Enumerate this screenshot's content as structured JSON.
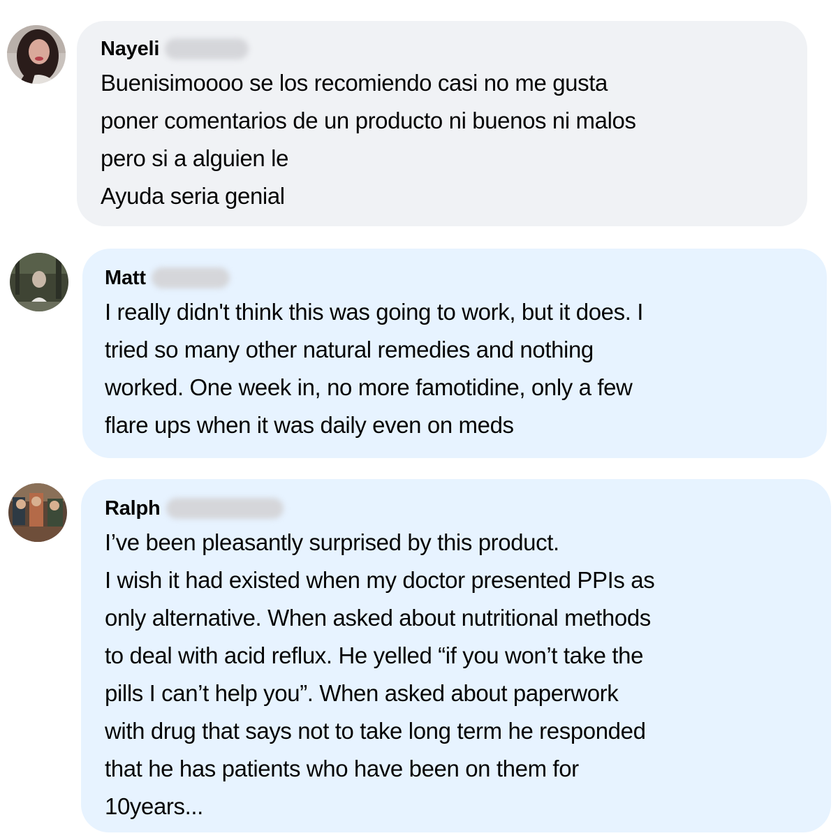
{
  "comments": [
    {
      "author": "Nayeli",
      "lines": [
        "Buenisimoooo se los recomiendo casi no me gusta",
        "poner comentarios de un producto ni buenos ni malos",
        "pero si a alguien le",
        "Ayuda seria genial"
      ],
      "bubble_color": "#f0f2f5"
    },
    {
      "author": "Matt",
      "lines": [
        "I really didn't think this was going to work, but it does. I",
        "tried so many other natural remedies and nothing",
        "worked. One week in, no more famotidine, only a few",
        "flare ups when it was daily even on meds"
      ],
      "bubble_color": "#e7f3ff"
    },
    {
      "author": "Ralph",
      "lines": [
        "I’ve been pleasantly surprised by this product.",
        "I wish it had existed when my doctor presented PPIs as",
        "only alternative. When asked about nutritional methods",
        "to deal with acid reflux. He yelled “if you won’t take the",
        "pills I can’t help you”. When asked about paperwork",
        "with drug that says not to take long term he responded",
        "that he has patients who have been on them for",
        "10years..."
      ],
      "bubble_color": "#e7f3ff"
    }
  ]
}
